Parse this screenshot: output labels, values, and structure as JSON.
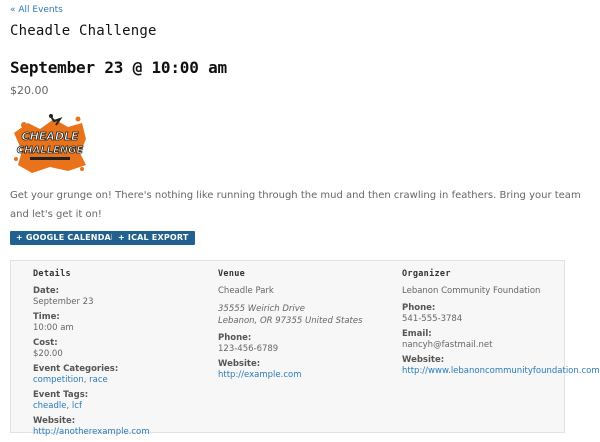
{
  "nav": {
    "back_label": "« All Events"
  },
  "event": {
    "title": "Cheadle Challenge",
    "datetime": "September 23 @ 10:00 am",
    "cost": "$20.00",
    "description": "Get your grunge on! There's nothing like running through the mud and then crawling in feathers. Bring your team and let's get it on!"
  },
  "logo": {
    "line1": "CHEADLE",
    "line2": "CHALLENGE"
  },
  "buttons": {
    "google": "+ GOOGLE CALENDAR",
    "ical": "+ ICAL EXPORT"
  },
  "details": {
    "heading": "Details",
    "date_label": "Date:",
    "date": "September 23",
    "time_label": "Time:",
    "time": "10:00 am",
    "cost_label": "Cost:",
    "cost": "$20.00",
    "categories_label": "Event Categories:",
    "categories": [
      "competition",
      "race"
    ],
    "tags_label": "Event Tags:",
    "tags": [
      "cheadle",
      "lcf"
    ],
    "website_label": "Website:",
    "website": "http://anotherexample.com"
  },
  "venue": {
    "heading": "Venue",
    "name": "Cheadle Park",
    "address1": "35555 Weirich Drive",
    "address2": "Lebanon, OR 97355 United States",
    "phone_label": "Phone:",
    "phone": "123-456-6789",
    "website_label": "Website:",
    "website": "http://example.com"
  },
  "organizer": {
    "heading": "Organizer",
    "name": "Lebanon Community Foundation",
    "phone_label": "Phone:",
    "phone": "541-555-3784",
    "email_label": "Email:",
    "email": "nancyh@fastmail.net",
    "website_label": "Website:",
    "website": "http://www.lebanoncommunityfoundation.com"
  },
  "colors": {
    "link": "#2a7ab8",
    "button_bg": "#20618f",
    "logo_orange": "#e8731a"
  }
}
